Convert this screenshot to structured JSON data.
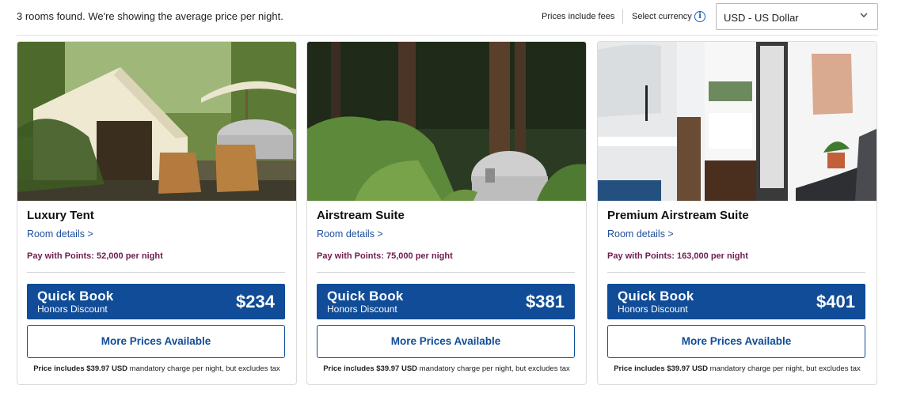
{
  "header": {
    "results_text": "3 rooms found. We're showing the average price per night.",
    "fees_text": "Prices include fees",
    "currency_label": "Select currency",
    "currency_value": "USD - US Dollar"
  },
  "rooms": [
    {
      "name": "Luxury Tent",
      "details_link": "Room details >",
      "points": "Pay with Points: 52,000 per night",
      "quick_book": "Quick Book",
      "discount": "Honors Discount",
      "price": "$234",
      "more_prices": "More Prices Available",
      "disclaimer_bold": "Price includes $39.97 USD",
      "disclaimer_rest": " mandatory charge per night, but excludes tax"
    },
    {
      "name": "Airstream Suite",
      "details_link": "Room details >",
      "points": "Pay with Points: 75,000 per night",
      "quick_book": "Quick Book",
      "discount": "Honors Discount",
      "price": "$381",
      "more_prices": "More Prices Available",
      "disclaimer_bold": "Price includes $39.97 USD",
      "disclaimer_rest": " mandatory charge per night, but excludes tax"
    },
    {
      "name": "Premium Airstream Suite",
      "details_link": "Room details >",
      "points": "Pay with Points: 163,000 per night",
      "quick_book": "Quick Book",
      "discount": "Honors Discount",
      "price": "$401",
      "more_prices": "More Prices Available",
      "disclaimer_bold": "Price includes $39.97 USD",
      "disclaimer_rest": " mandatory charge per night, but excludes tax"
    }
  ],
  "colors": {
    "brand_blue": "#104c97",
    "link_blue": "#1d4f9c",
    "points_plum": "#6e1d4d"
  },
  "icons": [
    "info-icon",
    "chevron-down-icon"
  ]
}
